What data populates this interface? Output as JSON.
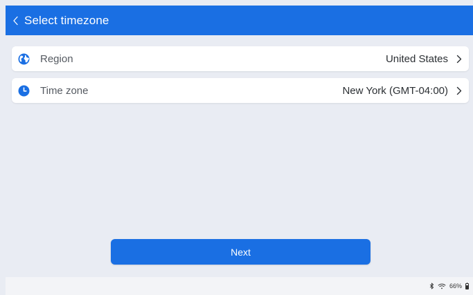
{
  "header": {
    "title": "Select timezone"
  },
  "rows": [
    {
      "label": "Region",
      "value": "United States",
      "icon": "globe-icon"
    },
    {
      "label": "Time zone",
      "value": "New York (GMT-04:00)",
      "icon": "clock-icon"
    }
  ],
  "next_label": "Next",
  "status": {
    "battery": "66%"
  },
  "colors": {
    "accent": "#1a6fe3",
    "background": "#e9ecf3",
    "card": "#ffffff"
  }
}
